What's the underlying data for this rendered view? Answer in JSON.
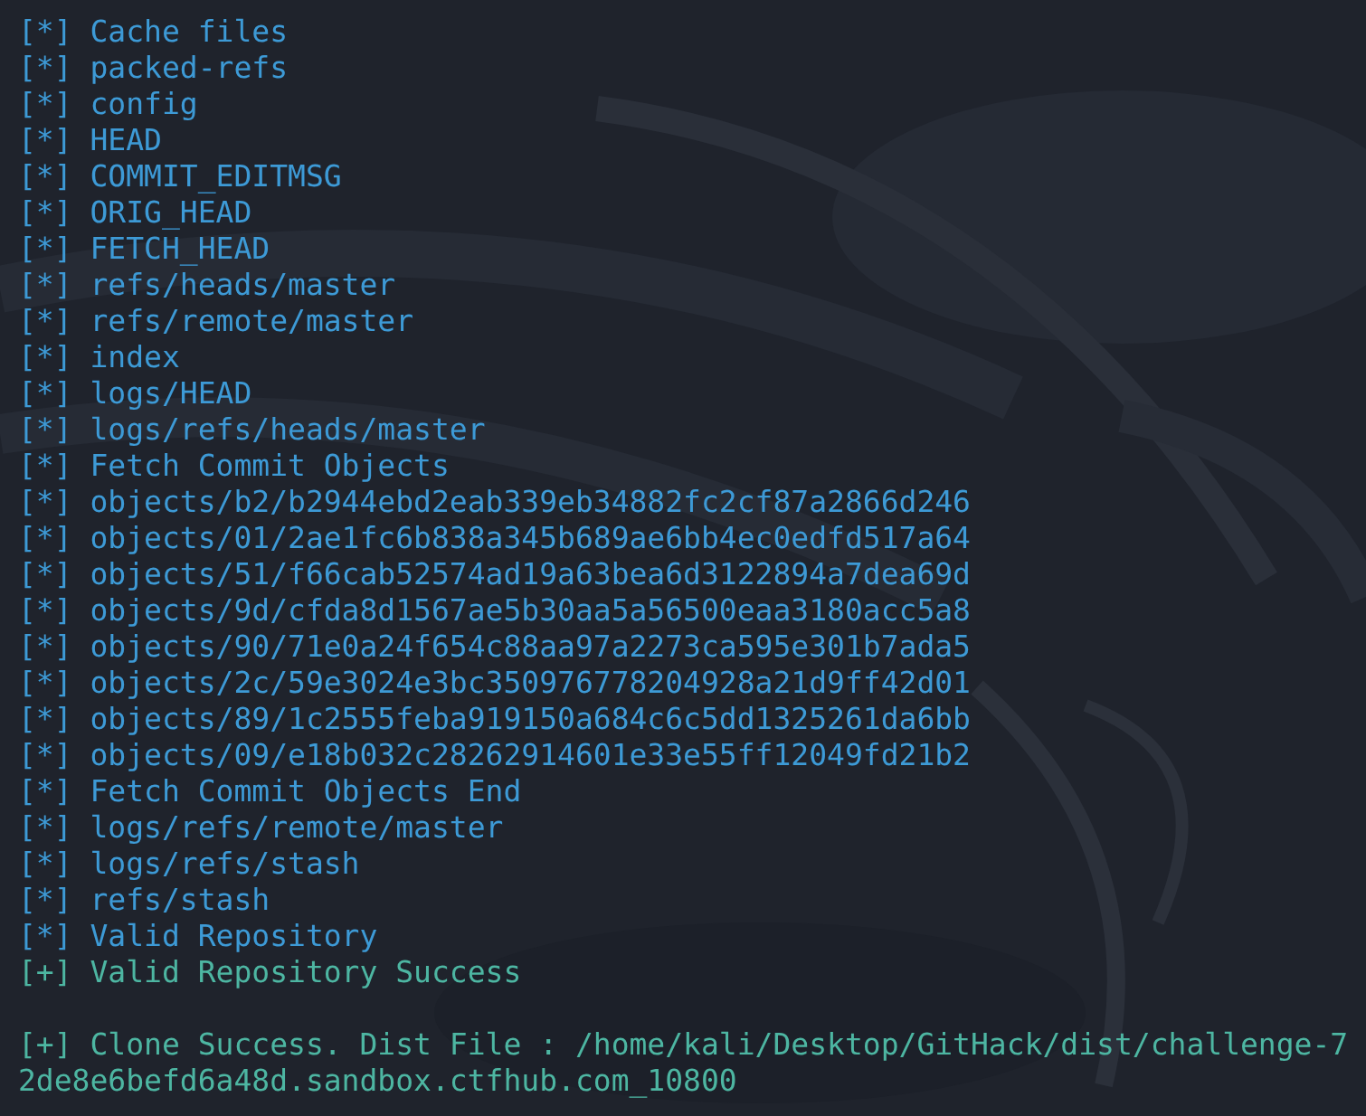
{
  "terminal": {
    "lines": [
      {
        "kind": "info",
        "text": "[*] Cache files"
      },
      {
        "kind": "info",
        "text": "[*] packed-refs"
      },
      {
        "kind": "info",
        "text": "[*] config"
      },
      {
        "kind": "info",
        "text": "[*] HEAD"
      },
      {
        "kind": "info",
        "text": "[*] COMMIT_EDITMSG"
      },
      {
        "kind": "info",
        "text": "[*] ORIG_HEAD"
      },
      {
        "kind": "info",
        "text": "[*] FETCH_HEAD"
      },
      {
        "kind": "info",
        "text": "[*] refs/heads/master"
      },
      {
        "kind": "info",
        "text": "[*] refs/remote/master"
      },
      {
        "kind": "info",
        "text": "[*] index"
      },
      {
        "kind": "info",
        "text": "[*] logs/HEAD"
      },
      {
        "kind": "info",
        "text": "[*] logs/refs/heads/master"
      },
      {
        "kind": "info",
        "text": "[*] Fetch Commit Objects"
      },
      {
        "kind": "info",
        "text": "[*] objects/b2/b2944ebd2eab339eb34882fc2cf87a2866d246"
      },
      {
        "kind": "info",
        "text": "[*] objects/01/2ae1fc6b838a345b689ae6bb4ec0edfd517a64"
      },
      {
        "kind": "info",
        "text": "[*] objects/51/f66cab52574ad19a63bea6d3122894a7dea69d"
      },
      {
        "kind": "info",
        "text": "[*] objects/9d/cfda8d1567ae5b30aa5a56500eaa3180acc5a8"
      },
      {
        "kind": "info",
        "text": "[*] objects/90/71e0a24f654c88aa97a2273ca595e301b7ada5"
      },
      {
        "kind": "info",
        "text": "[*] objects/2c/59e3024e3bc350976778204928a21d9ff42d01"
      },
      {
        "kind": "info",
        "text": "[*] objects/89/1c2555feba919150a684c6c5dd1325261da6bb"
      },
      {
        "kind": "info",
        "text": "[*] objects/09/e18b032c28262914601e33e55ff12049fd21b2"
      },
      {
        "kind": "info",
        "text": "[*] Fetch Commit Objects End"
      },
      {
        "kind": "info",
        "text": "[*] logs/refs/remote/master"
      },
      {
        "kind": "info",
        "text": "[*] logs/refs/stash"
      },
      {
        "kind": "info",
        "text": "[*] refs/stash"
      },
      {
        "kind": "info",
        "text": "[*] Valid Repository"
      },
      {
        "kind": "success",
        "text": "[+] Valid Repository Success"
      }
    ],
    "result": {
      "kind": "success",
      "text": "[+] Clone Success. Dist File : /home/kali/Desktop/GitHack/dist/challenge-72de8e6befd6a48d.sandbox.ctfhub.com_10800"
    }
  }
}
